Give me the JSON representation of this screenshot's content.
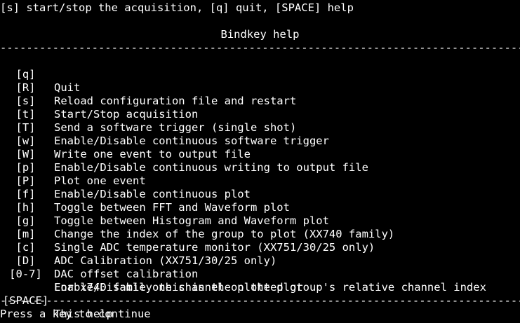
{
  "terminal": {
    "status_line": "[s] start/stop the acquisition, [q] quit, [SPACE] help",
    "title": "Bindkey help",
    "separator": "--------------------------------------------------------------------------------",
    "bindings": [
      {
        "key": "[q]",
        "desc": "Quit"
      },
      {
        "key": "[R]",
        "desc": "Reload configuration file and restart"
      },
      {
        "key": "[s]",
        "desc": "Start/Stop acquisition"
      },
      {
        "key": "[t]",
        "desc": "Send a software trigger (single shot)"
      },
      {
        "key": "[T]",
        "desc": "Enable/Disable continuous software trigger"
      },
      {
        "key": "[w]",
        "desc": "Write one event to output file"
      },
      {
        "key": "[W]",
        "desc": "Enable/Disable continuous writing to output file"
      },
      {
        "key": "[p]",
        "desc": "Plot one event"
      },
      {
        "key": "[P]",
        "desc": "Enable/Disable continuous plot"
      },
      {
        "key": "[f]",
        "desc": "Toggle between FFT and Waveform plot"
      },
      {
        "key": "[h]",
        "desc": "Toggle between Histogram and Waveform plot"
      },
      {
        "key": "[g]",
        "desc": "Change the index of the group to plot (XX740 family)"
      },
      {
        "key": "[m]",
        "desc": "Single ADC temperature monitor (XX751/30/25 only)"
      },
      {
        "key": "[c]",
        "desc": "ADC Calibration (XX751/30/25 only)"
      },
      {
        "key": "[D]",
        "desc": "DAC offset calibration"
      },
      {
        "key": "[0-7]",
        "desc": "Enable/Disable one channel on the plot"
      },
      {
        "key": "[SPACE]",
        "desc": "This help"
      }
    ],
    "continuation": "For x740 family this is the plotted group's relative channel index",
    "prompt": "Press a key to continue"
  },
  "colors": {
    "background": "#000000",
    "foreground": "#ffffff"
  }
}
